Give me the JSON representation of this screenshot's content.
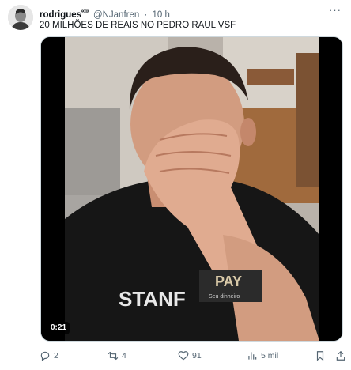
{
  "tweet": {
    "author_name": "rodrigues",
    "author_name_suffix": "ᵉᶜᶜᵖ",
    "handle": "@NJanfren",
    "separator": "·",
    "time": "10 h",
    "more_label": "···",
    "text": "20 MILHÕES DE REAIS NO PEDRO RAUL VSF",
    "media": {
      "type": "video",
      "duration": "0:21",
      "shirt_text_left": "STANF",
      "shirt_text_right": "PAY",
      "shirt_small_text": "Seu dinheiro"
    }
  },
  "actions": {
    "replies": "2",
    "retweets": "4",
    "likes": "91",
    "views": "5 mil"
  },
  "colors": {
    "text_primary": "#0f1419",
    "text_secondary": "#536471",
    "border": "#cfd9de",
    "video_background": "#000000"
  },
  "icons": {
    "reply": "reply-icon",
    "retweet": "retweet-icon",
    "like": "heart-icon",
    "views": "views-bar-icon",
    "bookmark": "bookmark-icon",
    "share": "share-icon"
  }
}
